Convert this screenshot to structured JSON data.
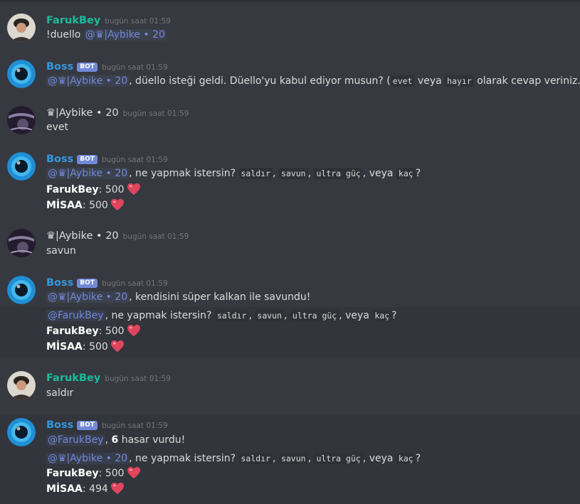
{
  "users": {
    "faruk": "FarukBey",
    "boss": "Boss",
    "aybike": "♛|Aybike • 20",
    "bot_tag": "BOT"
  },
  "timestamp": "bugün saat 01:59",
  "messages": {
    "m1": {
      "prefix": "!duello",
      "mention": "@♛|Aybike • 20"
    },
    "m2": {
      "mention": "@♛|Aybike • 20",
      "t1": ", düello isteği geldi. Düello'yu kabul ediyor musun? (",
      "c1": "evet",
      "t2": " veya ",
      "c2": "hayır",
      "t3": " olarak cevap veriniz.)"
    },
    "m3": {
      "text": "evet"
    },
    "m4": {
      "mention": "@♛|Aybike • 20",
      "t1": ", ne yapmak istersin? ",
      "c1": "saldır",
      "s1": ", ",
      "c2": "savun",
      "s2": ", ",
      "c3": "ultra güç",
      "s3": ", veya ",
      "c4": "kaç",
      "s4": "?",
      "stat1_name": "FarukBey",
      "stat1_val": ": 500",
      "stat2_name": "MİSAA",
      "stat2_val": ": 500"
    },
    "m5": {
      "text": "savun"
    },
    "m6": {
      "mention": "@♛|Aybike • 20",
      "t1": ", kendisini süper kalkan ile savundu!",
      "mention2": "@FarukBey",
      "q1": ", ne yapmak istersin? ",
      "c1": "saldır",
      "s1": ", ",
      "c2": "savun",
      "s2": ", ",
      "c3": "ultra güç",
      "s3": ", veya ",
      "c4": "kaç",
      "s4": "?",
      "stat1_name": "FarukBey",
      "stat1_val": ": 500",
      "stat2_name": "MİSAA",
      "stat2_val": ": 500"
    },
    "m7": {
      "text": "saldır"
    },
    "m8": {
      "mention": "@FarukBey",
      "t1": ", ",
      "dmg": "6",
      "t2": " hasar vurdu!",
      "mention2": "@♛|Aybike • 20",
      "q1": ", ne yapmak istersin? ",
      "c1": "saldır",
      "s1": ", ",
      "c2": "savun",
      "s2": ", ",
      "c3": "ultra güç",
      "s3": ", veya ",
      "c4": "kaç",
      "s4": "?",
      "stat1_name": "FarukBey",
      "stat1_val": ": 500",
      "stat2_name": "MİSAA",
      "stat2_val": ": 494"
    }
  },
  "colors": {
    "faruk": "#1abc9c",
    "boss": "#3498db",
    "mention": "#7289da",
    "heart": "#e0455e"
  },
  "icons": [
    "heart-icon",
    "avatar-farukbey",
    "avatar-boss",
    "avatar-aybike"
  ]
}
